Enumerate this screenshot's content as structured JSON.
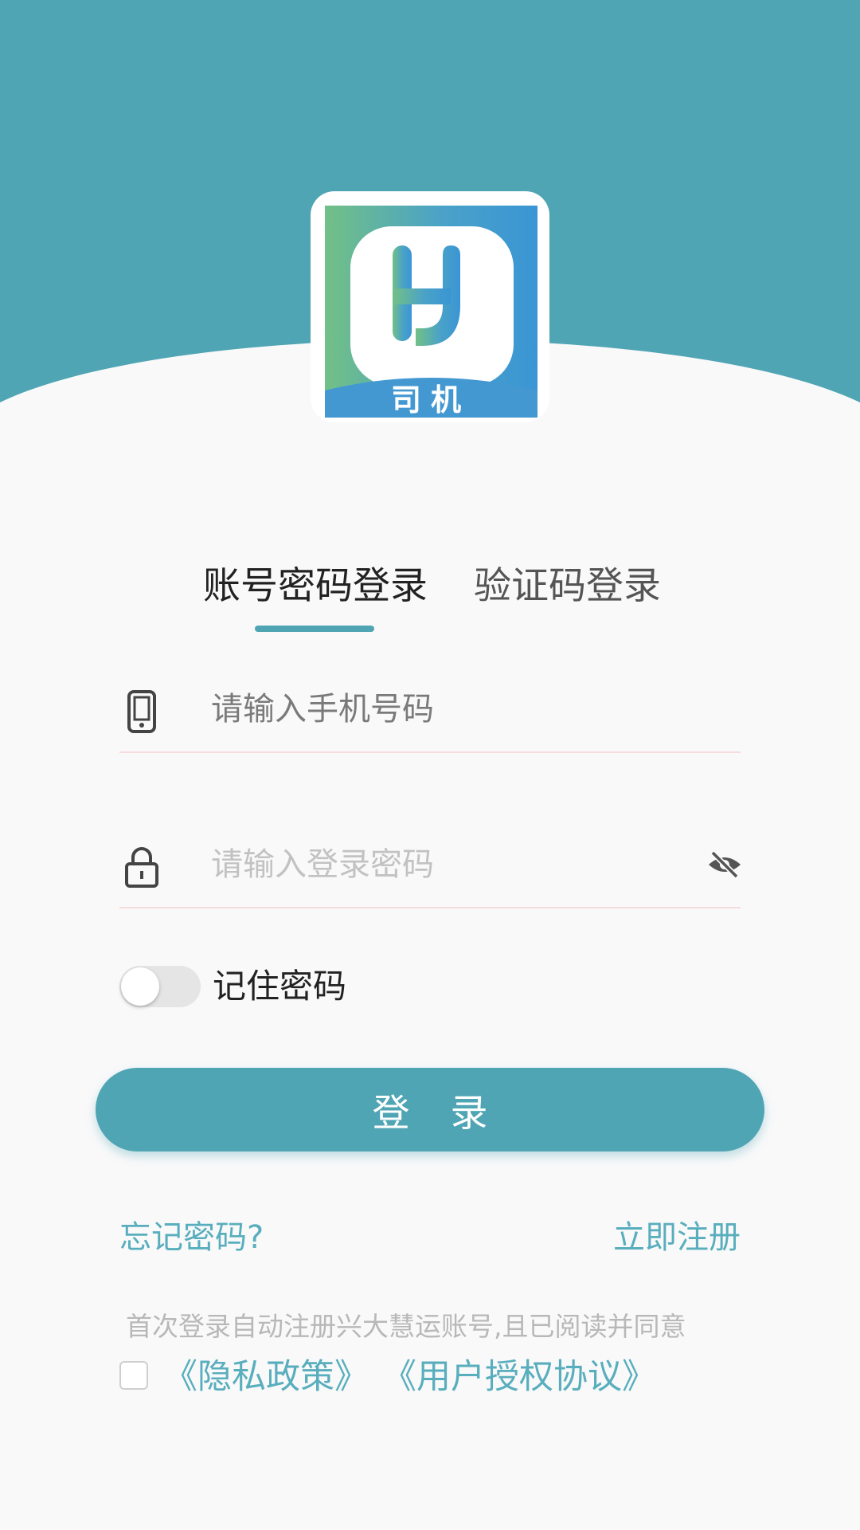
{
  "colors": {
    "brand": "#4fa5b4",
    "link": "#59aebd",
    "page_background": "#f9f9fa"
  },
  "logo": {
    "icon": "app-logo-h",
    "text": "司机"
  },
  "tabs": [
    {
      "label": "账号密码登录",
      "active": true
    },
    {
      "label": "验证码登录",
      "active": false
    }
  ],
  "form": {
    "phone": {
      "icon": "phone-icon",
      "placeholder": "请输入手机号码",
      "value": ""
    },
    "password": {
      "icon": "lock-icon",
      "placeholder": "请输入登录密码",
      "value": "",
      "visibility_icon": "eye-off-icon"
    },
    "remember": {
      "label": "记住密码",
      "checked": false
    },
    "login_label": "登 录"
  },
  "links": {
    "forgot_password": "忘记密码?",
    "register": "立即注册"
  },
  "agreement": {
    "text": "首次登录自动注册兴大慧运账号,且已阅读并同意",
    "checked": false,
    "privacy_policy": "《隐私政策》",
    "user_agreement": "《用户授权协议》"
  }
}
